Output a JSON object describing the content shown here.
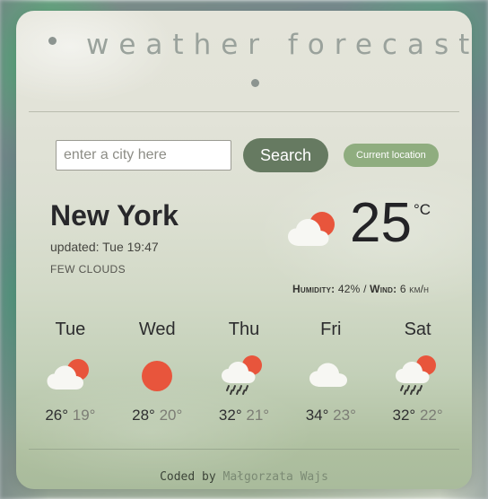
{
  "header": {
    "title": "weather forecast",
    "dot_left": "bullet-dot",
    "dot_center": "bullet-dot"
  },
  "search": {
    "placeholder": "enter a city here",
    "value": "",
    "search_label": "Search",
    "location_label": "Current location",
    "search_button_color": "#667a61",
    "location_button_color": "#8fad7f"
  },
  "current": {
    "city": "New York",
    "updated": "updated: Tue 19:47",
    "description": "FEW CLOUDS",
    "temperature": "25",
    "unit": "°C",
    "icon": "sun-behind-cloud-icon",
    "humidity_label": "Humidity:",
    "humidity_value": "42%",
    "separator": "/",
    "wind_label": "Wind:",
    "wind_value": "6 km/h"
  },
  "forecast": [
    {
      "day": "Tue",
      "icon": "sun-behind-cloud-icon",
      "high": "26°",
      "low": "19°"
    },
    {
      "day": "Wed",
      "icon": "sun-icon",
      "high": "28°",
      "low": "20°"
    },
    {
      "day": "Thu",
      "icon": "sun-behind-rain-cloud-icon",
      "high": "32°",
      "low": "21°"
    },
    {
      "day": "Fri",
      "icon": "cloud-icon",
      "high": "34°",
      "low": "23°"
    },
    {
      "day": "Sat",
      "icon": "sun-behind-rain-cloud-icon",
      "high": "32°",
      "low": "22°"
    }
  ],
  "footer": {
    "credit": "Coded by ",
    "author": "Małgorzata Wajs"
  },
  "colors": {
    "sun": "#e8553c",
    "cloud": "#f7f7f3",
    "rain": "#3a3a38",
    "card_top": "#e4e4da",
    "card_bottom": "#a9bb9c"
  }
}
